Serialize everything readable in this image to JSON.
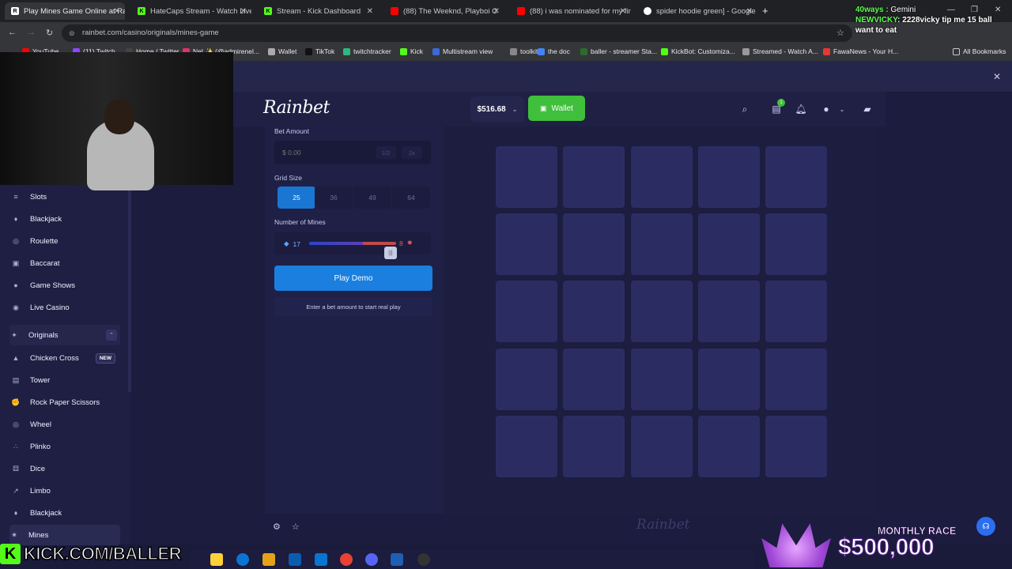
{
  "browser": {
    "tabs": [
      {
        "title": "Play Mines Game Online at Rai",
        "active": true
      },
      {
        "title": "HateCaps Stream - Watch Live o"
      },
      {
        "title": "Stream - Kick Dashboard"
      },
      {
        "title": "(88) The Weeknd, Playboi C"
      },
      {
        "title": "(88) i was nominated for my fir"
      },
      {
        "title": "spider hoodie green] - Google"
      }
    ],
    "new_tab": "+",
    "url": "rainbet.com/casino/originals/mines-game",
    "bookmarks": [
      {
        "label": "YouTube",
        "color": "#ff0000"
      },
      {
        "label": "(11) Twitch",
        "color": "#9146ff"
      },
      {
        "label": "Home / Twitter",
        "color": "#444444"
      },
      {
        "label": "Nel ✨ (@admirenel...",
        "color": "#e1306c"
      },
      {
        "label": "Wallet",
        "color": "#aaaaaa"
      },
      {
        "label": "TikTok",
        "color": "#111111"
      },
      {
        "label": "twitchtracker",
        "color": "#2db87d"
      },
      {
        "label": "Kick",
        "color": "#53fc18"
      },
      {
        "label": "Multistream view",
        "color": "#3a6ad8"
      },
      {
        "label": "toolkit",
        "color": "#888888"
      },
      {
        "label": "the doc",
        "color": "#4285f4"
      },
      {
        "label": "baller - streamer Sta...",
        "color": "#2b6b2b"
      },
      {
        "label": "KickBot: Customiza...",
        "color": "#53fc18"
      },
      {
        "label": "Streamed - Watch A...",
        "color": "#999999"
      },
      {
        "label": "FawaNews - Your H...",
        "color": "#e53935"
      }
    ],
    "all_bookmarks": "All Bookmarks"
  },
  "header": {
    "logo": "Rainbet",
    "balance": "$516.68",
    "wallet": "Wallet",
    "notif_count": "1"
  },
  "sidebar": {
    "items": [
      {
        "label": "Slots",
        "icon": "slots-icon",
        "glyph": "≡"
      },
      {
        "label": "Blackjack",
        "icon": "blackjack-icon",
        "glyph": "♦"
      },
      {
        "label": "Roulette",
        "icon": "roulette-icon",
        "glyph": "◎"
      },
      {
        "label": "Baccarat",
        "icon": "baccarat-icon",
        "glyph": "▣"
      },
      {
        "label": "Game Shows",
        "icon": "game-shows-icon",
        "glyph": "●"
      },
      {
        "label": "Live Casino",
        "icon": "live-casino-icon",
        "glyph": "◉"
      }
    ],
    "originals_label": "Originals",
    "originals": [
      {
        "label": "Chicken Cross",
        "icon": "chicken-cross-icon",
        "glyph": "▲",
        "badge": "NEW"
      },
      {
        "label": "Tower",
        "icon": "tower-icon",
        "glyph": "▤"
      },
      {
        "label": "Rock Paper Scissors",
        "icon": "rps-icon",
        "glyph": "✊"
      },
      {
        "label": "Wheel",
        "icon": "wheel-icon",
        "glyph": "◎"
      },
      {
        "label": "Plinko",
        "icon": "plinko-icon",
        "glyph": "∴"
      },
      {
        "label": "Dice",
        "icon": "dice-icon",
        "glyph": "⚄"
      },
      {
        "label": "Limbo",
        "icon": "limbo-icon",
        "glyph": "↗"
      },
      {
        "label": "Blackjack",
        "icon": "blackjack-icon",
        "glyph": "♦"
      },
      {
        "label": "Mines",
        "icon": "mines-icon",
        "glyph": "✷"
      }
    ]
  },
  "game": {
    "bet_label": "Bet Amount",
    "bet_placeholder": "$ 0.00",
    "half": "1/2",
    "double": "2x",
    "grid_label": "Grid Size",
    "grid_options": [
      "25",
      "36",
      "49",
      "64"
    ],
    "grid_selected": "25",
    "mines_label": "Number of Mines",
    "gems": "17",
    "mines": "8",
    "slider_fraction": 0.32,
    "play_demo": "Play Demo",
    "bet_message": "Enter a bet amount to start real play",
    "footer_logo": "Rainbet"
  },
  "overlays": {
    "chat_prefix": "40ways : ",
    "chat_gemini": "Gemini",
    "chat_user": "NEWVICKY",
    "chat_message": ": 2228vicky tip me 15 ball want to eat",
    "kick_text": "KICK.COM/BALLER",
    "kick_logo": "K",
    "race_title": "MONTHLY RACE",
    "race_amount": "$500,000"
  }
}
